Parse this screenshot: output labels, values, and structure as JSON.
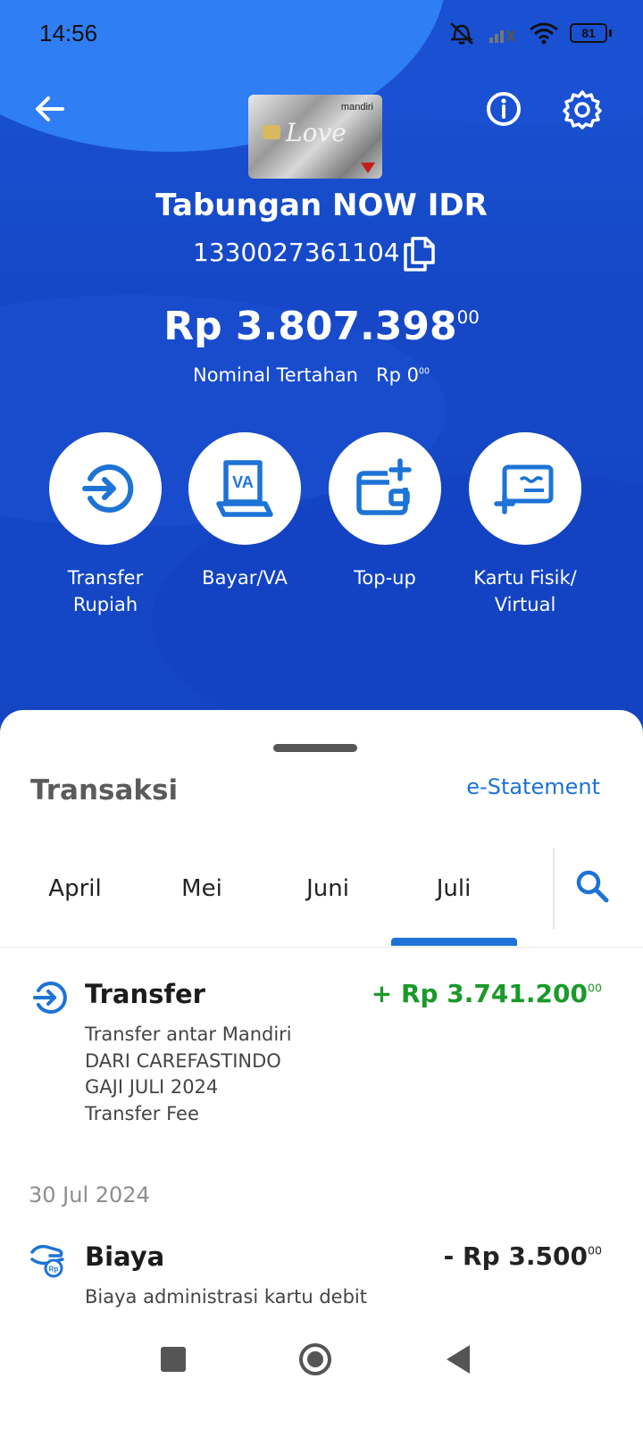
{
  "status_bar": {
    "time": "14:56",
    "battery": "81"
  },
  "account": {
    "name": "Tabungan NOW IDR",
    "number": "1330027361104",
    "balance_main": "Rp 3.807.398",
    "balance_cents": "00",
    "hold_label": "Nominal Tertahan",
    "hold_value": "Rp 0",
    "hold_cents": "00",
    "card_brand": "mandiri"
  },
  "actions": [
    {
      "line1": "Transfer",
      "line2": "Rupiah",
      "icon": "transfer-icon"
    },
    {
      "line1": "Bayar/VA",
      "line2": "",
      "icon": "va-icon"
    },
    {
      "line1": "Top-up",
      "line2": "",
      "icon": "wallet-plus-icon"
    },
    {
      "line1": "Kartu Fisik/",
      "line2": "Virtual",
      "icon": "card-plus-icon"
    }
  ],
  "transactions_section": {
    "title": "Transaksi",
    "estatement": "e-Statement",
    "tabs": [
      "April",
      "Mei",
      "Juni",
      "Juli"
    ],
    "selected_tab": "Juli"
  },
  "transactions": [
    {
      "name": "Transfer",
      "amount": "+ Rp 3.741.200",
      "cents": "00",
      "desc1": "Transfer antar Mandiri",
      "desc2": "DARI CAREFASTINDO",
      "desc3": "GAJI JULI 2024",
      "desc4": "Transfer Fee",
      "color": "#1a9a2a"
    },
    {
      "date": "30 Jul 2024",
      "name": "Biaya",
      "amount": "- Rp 3.500",
      "cents": "00",
      "desc1": "Biaya administrasi kartu debit",
      "color": "#222222"
    }
  ],
  "colors": {
    "primary": "#1448c8",
    "accent": "#1d73d6",
    "credit": "#1a9a2a"
  }
}
